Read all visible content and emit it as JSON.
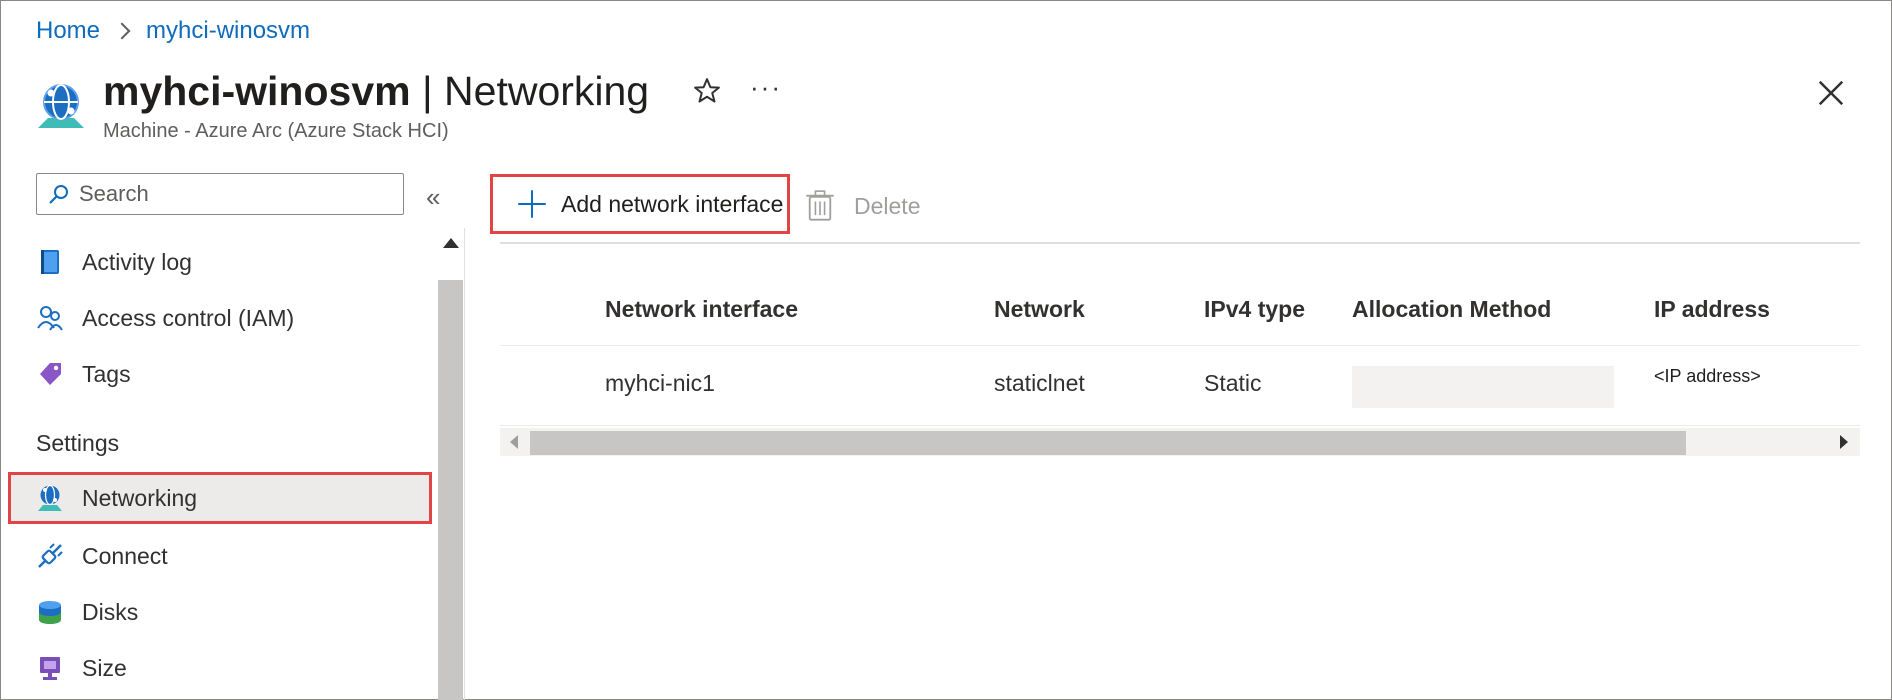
{
  "breadcrumb": {
    "home": "Home",
    "resource": "myhci-winosvm"
  },
  "header": {
    "resource_name": "myhci-winosvm",
    "separator": " | ",
    "blade_name": "Networking",
    "subtitle": "Machine - Azure Arc (Azure Stack HCI)",
    "more_label": "···"
  },
  "sidebar": {
    "search": {
      "placeholder": "Search",
      "value": ""
    },
    "collapse_label": "«",
    "items_top": [
      {
        "label": "Activity log",
        "icon": "activity-log-icon"
      },
      {
        "label": "Access control (IAM)",
        "icon": "people-icon"
      },
      {
        "label": "Tags",
        "icon": "tag-icon"
      }
    ],
    "settings_title": "Settings",
    "items_settings": [
      {
        "label": "Networking",
        "icon": "networking-icon",
        "selected": true
      },
      {
        "label": "Connect",
        "icon": "connect-plug-icon"
      },
      {
        "label": "Disks",
        "icon": "disks-icon"
      },
      {
        "label": "Size",
        "icon": "size-monitor-icon"
      }
    ]
  },
  "toolbar": {
    "add_label": "Add network interface",
    "delete_label": "Delete"
  },
  "table": {
    "columns": [
      "Network interface",
      "Network",
      "IPv4 type",
      "Allocation Method",
      "IP address"
    ],
    "rows": [
      {
        "network_interface": "myhci-nic1",
        "network": "staticlnet",
        "ipv4_type": "Static",
        "allocation_method": "",
        "ip_address": "<IP address>"
      }
    ]
  },
  "colors": {
    "accent": "#0f6cbd",
    "highlight_border": "#e04444",
    "selected_bg": "#edebe9"
  }
}
